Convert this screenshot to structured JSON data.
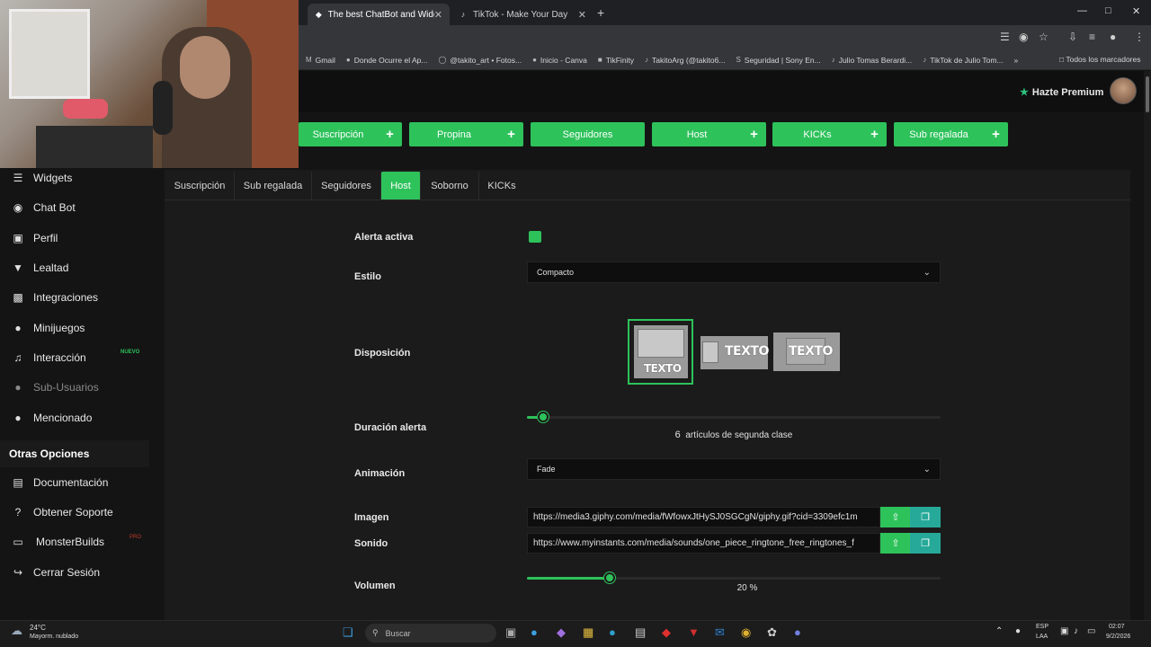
{
  "browser": {
    "tabs": [
      {
        "title": "The best ChatBot and Widgets",
        "active": true
      },
      {
        "title": "TikTok - Make Your Day",
        "active": false
      }
    ],
    "new_tab": "+",
    "window_controls": {
      "minimize": "—",
      "maximize": "□",
      "close": "✕"
    },
    "bookmarks": [
      {
        "label": "Gmail",
        "icon": "gmail-icon"
      },
      {
        "label": "Donde Ocurre el Ap...",
        "icon": "globe-icon"
      },
      {
        "label": "@takito_art • Fotos...",
        "icon": "instagram-icon"
      },
      {
        "label": "Inicio - Canva",
        "icon": "canva-icon"
      },
      {
        "label": "TikFinity",
        "icon": "tikfinity-icon"
      },
      {
        "label": "TakitoArg (@takito6...",
        "icon": "tiktok-icon"
      },
      {
        "label": "Seguridad | Sony En...",
        "icon": "sony-icon"
      },
      {
        "label": "Julio Tomas Berardi...",
        "icon": "tiktok-icon"
      },
      {
        "label": "TikTok de Julio Tom...",
        "icon": "tiktok-icon"
      }
    ],
    "bookmarks_more": "»",
    "all_bookmarks": "Todos los marcadores"
  },
  "header": {
    "premium_label": "Hazte Premium"
  },
  "event_buttons": [
    {
      "label": "Suscripción",
      "plus": true
    },
    {
      "label": "Propina",
      "plus": true
    },
    {
      "label": "Seguidores",
      "plus": false
    },
    {
      "label": "Host",
      "plus": true
    },
    {
      "label": "KICKs",
      "plus": true
    },
    {
      "label": "Sub regalada",
      "plus": true
    }
  ],
  "sidebar": {
    "items": [
      {
        "label": "Widgets",
        "icon": "layers-icon"
      },
      {
        "label": "Chat Bot",
        "icon": "robot-icon"
      },
      {
        "label": "Perfil",
        "icon": "id-card-icon"
      },
      {
        "label": "Lealtad",
        "icon": "trophy-icon"
      },
      {
        "label": "Integraciones",
        "icon": "plug-icon"
      },
      {
        "label": "Minijuegos",
        "icon": "gamepad-icon"
      },
      {
        "label": "Interacción",
        "icon": "music-icon",
        "badge": "NUEVO"
      },
      {
        "label": "Sub-Usuarios",
        "icon": "user-plus-icon",
        "disabled": true
      },
      {
        "label": "Mencionado",
        "icon": "users-icon"
      }
    ],
    "section_title": "Otras Opciones",
    "other_items": [
      {
        "label": "Documentación",
        "icon": "book-icon"
      },
      {
        "label": "Obtener Soporte",
        "icon": "question-icon"
      },
      {
        "label": "MonsterBuilds",
        "icon": "laptop-icon",
        "badge": "PRO"
      },
      {
        "label": "Cerrar Sesión",
        "icon": "logout-icon"
      }
    ]
  },
  "subtabs": [
    {
      "label": "Suscripción",
      "active": false
    },
    {
      "label": "Sub regalada",
      "active": false
    },
    {
      "label": "Seguidores",
      "active": false
    },
    {
      "label": "Host",
      "active": true
    },
    {
      "label": "Soborno",
      "active": false
    },
    {
      "label": "KICKs",
      "active": false
    }
  ],
  "form": {
    "alerta_activa": {
      "label": "Alerta activa",
      "checked": true
    },
    "estilo": {
      "label": "Estilo",
      "value": "Compacto"
    },
    "disposicion": {
      "label": "Disposición",
      "option_text": "TEXTO",
      "selected": 0
    },
    "duracion": {
      "label": "Duración alerta",
      "value": "6",
      "unit": "artículos de segunda clase",
      "fraction": 0.04
    },
    "animacion": {
      "label": "Animación",
      "value": "Fade"
    },
    "imagen": {
      "label": "Imagen",
      "value": "https://media3.giphy.com/media/fWfowxJtHySJ0SGCgN/giphy.gif?cid=3309efc1m"
    },
    "sonido": {
      "label": "Sonido",
      "value": "https://www.myinstants.com/media/sounds/one_piece_ringtone_free_ringtones_f"
    },
    "volumen": {
      "label": "Volumen",
      "value": "20",
      "unit": "%",
      "fraction": 0.2
    }
  },
  "taskbar": {
    "weather_temp": "24°C",
    "weather_desc": "Mayorm. nublado",
    "search_placeholder": "Buscar",
    "lang_line1": "ESP",
    "lang_line2": "LAA",
    "time": "02:07",
    "date": "9/2/2026"
  },
  "colors": {
    "accent": "#2ec25b",
    "background": "#141414",
    "panel": "#1b1b1b"
  }
}
